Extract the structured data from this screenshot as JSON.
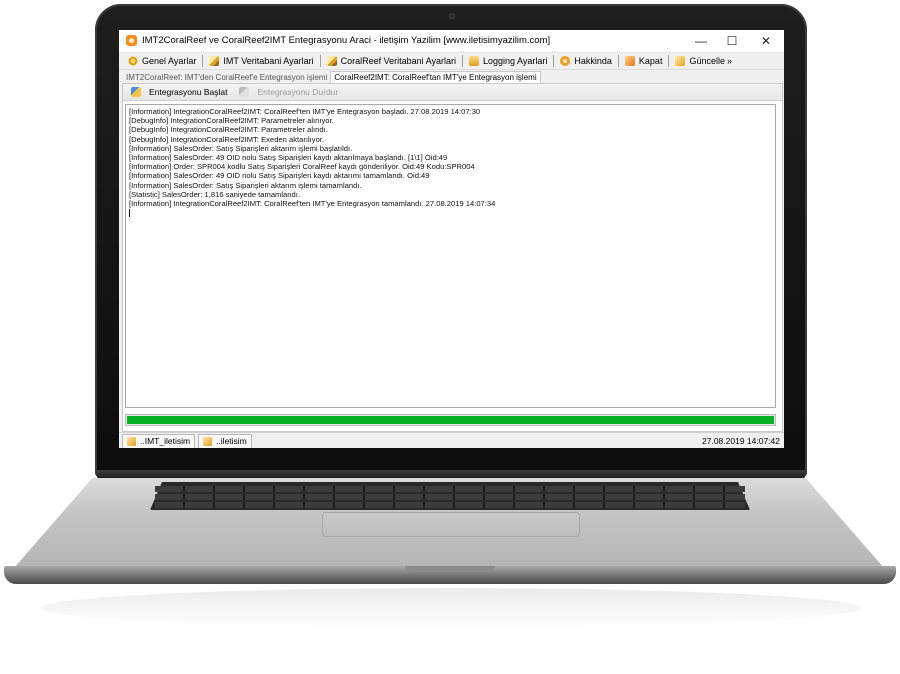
{
  "window": {
    "title": "IMT2CoralReef ve CoralReef2IMT Entegrasyonu Araci - iletişim Yazilim [www.iletisimyazilim.com]",
    "minimize": "—",
    "maximize": "☐",
    "close": "✕"
  },
  "menu": {
    "items": [
      {
        "label": "Genel Ayarlar",
        "icon": "gear-icon"
      },
      {
        "label": "IMT Veritabani Ayarlari",
        "icon": "pencil-icon"
      },
      {
        "label": "CoralReef Veritabani Ayarlari",
        "icon": "pencil-icon"
      },
      {
        "label": "Logging Ayarlari",
        "icon": "log-icon"
      },
      {
        "label": "Hakkinda",
        "icon": "info-icon"
      },
      {
        "label": "Kapat",
        "icon": "exit-icon"
      },
      {
        "label": "Güncelle",
        "icon": "update-icon"
      }
    ],
    "overflow": "»"
  },
  "tabs": [
    {
      "label": "IMT2CoralReef: IMT'den CoralReef'e Entegrasyon işlemi",
      "active": false
    },
    {
      "label": "CoralReef2IMT: CoralReef'tan IMT'ye Entegrasyon işlemi",
      "active": true
    }
  ],
  "toolbar": {
    "start_label": "Entegrasyonu Başlat",
    "stop_label": "Entegrasyonu Durdur"
  },
  "log": {
    "lines": [
      "[Information] IntegrationCoralReef2IMT: CoralReef'ten IMT'ye Entegrasyon başladı. 27.08.2019 14:07:30",
      "[DebugInfo] IntegrationCoralReef2IMT: Parametreler alınıyor.",
      "[DebugInfo] IntegrationCoralReef2IMT: Parametreler alındı.",
      "[DebugInfo] IntegrationCoralReef2IMT: Exeden aktarılıyor.",
      "[Information] SalesOrder: Satış Siparişleri aktarım işlemi başlatıldı.",
      "[Information] SalesOrder: 49 OID nolu Satış Siparişleri kaydı aktarılmaya başlandı. [1\\1] Oid:49",
      "[Information] Order: SPR004 kodlu Satış Siparişleri CoralReef kaydı gönderiliyor. Oid:49 Kodu:SPR004",
      "[Information] SalesOrder: 49 OID nolu Satış Siparişleri kaydı aktarımı tamamlandı. Oid:49",
      "[Information] SalesOrder: Satış Siparişleri aktarım işlemi tamamlandı.",
      "[Statistic] SalesOrder: 1,816 saniyede tamamlandı.",
      "[Information] IntegrationCoralReef2IMT: CoralReef'ten IMT'ye Entegrasyon tamamlandı. 27.08.2019 14:07:34"
    ]
  },
  "progress": {
    "value": 1.0,
    "color": "#06b025"
  },
  "status": {
    "item1": "..IMT_iletisim",
    "item2": "..iletisim",
    "timestamp": "27.08.2019 14:07:42"
  }
}
